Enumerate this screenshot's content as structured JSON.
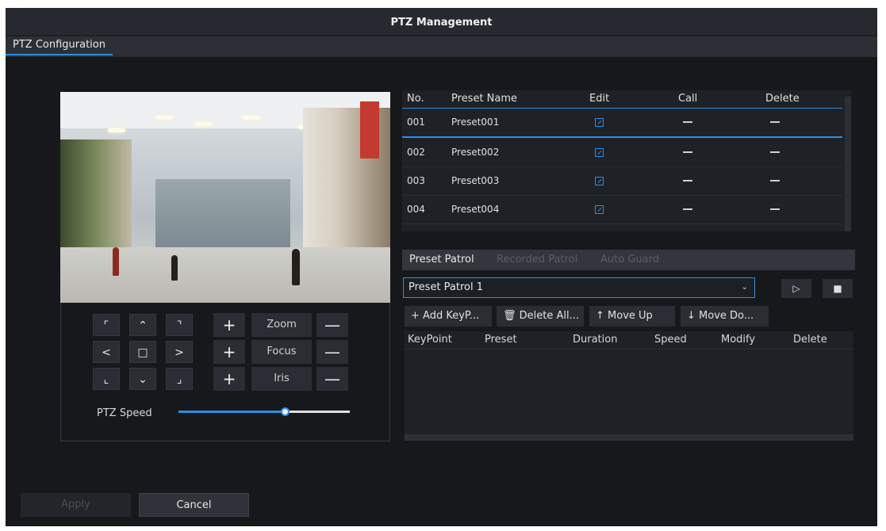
{
  "window": {
    "title": "PTZ Management"
  },
  "tabs": [
    {
      "label": "PTZ Configuration"
    }
  ],
  "ptz": {
    "directions": {
      "up_left": "⌜",
      "up": "⌃",
      "up_right": "⌝",
      "left": "<",
      "center": "□",
      "right": ">",
      "down_left": "⌞",
      "down": "⌄",
      "down_right": "⌟"
    },
    "plus": "+",
    "minus": "—",
    "zoom_label": "Zoom",
    "focus_label": "Focus",
    "iris_label": "Iris",
    "speed_label": "PTZ Speed",
    "speed_fraction": 0.62
  },
  "preset_table": {
    "headers": {
      "no": "No.",
      "name": "Preset Name",
      "edit": "Edit",
      "call": "Call",
      "delete": "Delete"
    },
    "dash": "—",
    "rows": [
      {
        "no": "001",
        "name": "Preset001"
      },
      {
        "no": "002",
        "name": "Preset002"
      },
      {
        "no": "003",
        "name": "Preset003"
      },
      {
        "no": "004",
        "name": "Preset004"
      }
    ]
  },
  "patrol": {
    "tabs": [
      "Preset Patrol",
      "Recorded Patrol",
      "Auto Guard"
    ],
    "selected": "Preset Patrol 1",
    "chevron": "⌄",
    "play_icon": "▷",
    "stop_icon": "■",
    "actions": {
      "add": "+ Add KeyP...",
      "delete_all": "🗑 Delete All...",
      "move_up": "↑  Move Up",
      "move_down": "↓  Move Do..."
    },
    "keypoint_headers": {
      "keypoint": "KeyPoint",
      "preset": "Preset",
      "duration": "Duration",
      "speed": "Speed",
      "modify": "Modify",
      "delete": "Delete"
    }
  },
  "footer": {
    "apply": "Apply",
    "cancel": "Cancel"
  },
  "colors": {
    "accent": "#2e8ee0",
    "background": "#16181c"
  }
}
